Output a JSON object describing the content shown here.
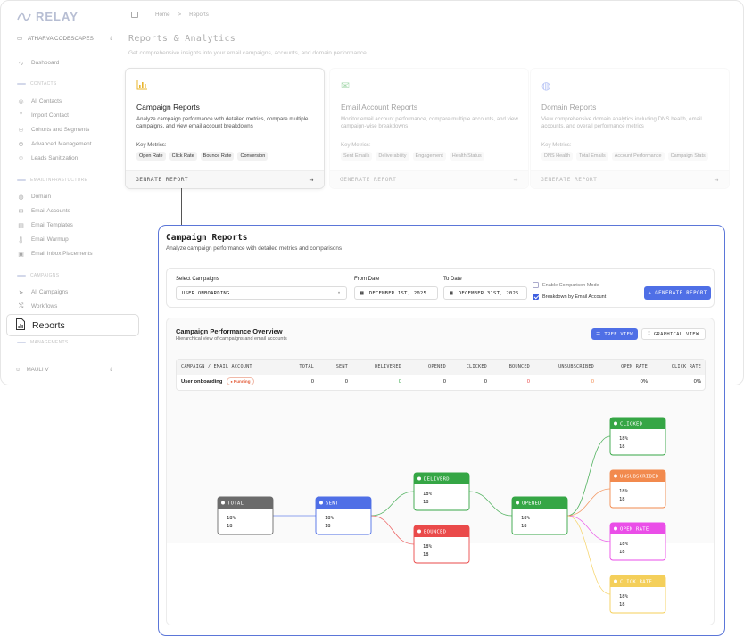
{
  "app": {
    "logo_text": "RELAY",
    "workspace": "ATHARVA CODESCAPES",
    "user": "MAULI V"
  },
  "sidebar": {
    "dashboard": "Dashboard",
    "sections": {
      "contacts": "CONTACTS",
      "email_infra": "EMAIL INFRASTUCTURE",
      "campaigns": "CAMPAIGNS",
      "management": "MANAGEMENTS"
    },
    "contacts_items": [
      "All Contacts",
      "Import Contact",
      "Cohorts and Segments",
      "Advanced Management",
      "Leads Sanitization"
    ],
    "infra_items": [
      "Domain",
      "Email Accounts",
      "Email Templates",
      "Email Warmup",
      "Email Inbox Placements"
    ],
    "campaign_items": [
      "All Campaigns",
      "Workflows"
    ],
    "active": "Reports"
  },
  "breadcrumb": {
    "home": "Home",
    "sep": ">",
    "current": "Reports"
  },
  "page": {
    "title": "Reports & Analytics",
    "subtitle": "Get comprehensive insights into your email campaigns, accounts, and domain performance"
  },
  "cards": [
    {
      "title": "Campaign Reports",
      "desc": "Analyze campaign performance with detailed metrics, compare multiple campaigns, and view email account breakdowns",
      "metrics_label": "Key Metrics:",
      "metrics": [
        "Open Rate",
        "Click Rate",
        "Bounce Rate",
        "Conversion"
      ],
      "action": "GENRATE REPORT"
    },
    {
      "title": "Email Account Reports",
      "desc": "Monitor email account performance, compare multiple accounts, and view campaign-wise breakdowns",
      "metrics_label": "Key Metrics:",
      "metrics": [
        "Sent Emails",
        "Deliverability",
        "Engagement",
        "Health Status"
      ],
      "action": "GENERATE REPORT"
    },
    {
      "title": "Domain Reports",
      "desc": "View comprehensive domain analytics including DNS health, email accounts, and overall performance metrics",
      "metrics_label": "Key Metrics:",
      "metrics": [
        "DNS Health",
        "Total Emails",
        "Account Performance",
        "Campaign Stats"
      ],
      "action": "GENERATE REPORT"
    }
  ],
  "panel": {
    "title": "Campaign Reports",
    "subtitle": "Analyze campaign performance with detailed metrics and comparisons",
    "filters": {
      "campaigns_label": "Select Campaigns",
      "campaigns_value": "USER ONBOARDING",
      "from_label": "From Date",
      "from_value": "DECEMBER 1ST, 2025",
      "to_label": "To Date",
      "to_value": "DECEMBER 31ST, 2025",
      "comparison": {
        "label": "Enable Comparison Mode",
        "checked": false
      },
      "breakdown": {
        "label": "Breakdown by Email Account",
        "checked": true
      },
      "generate": "GENERATE REPORT"
    },
    "overview": {
      "title": "Campaign Performance Overview",
      "subtitle": "Hierarchical view of campaigns and email accounts",
      "tree_view": "TREE VIEW",
      "graphical_view": "GRAPHICAL VIEW",
      "columns": [
        "CAMPAIGN / EMAIL ACCOUNT",
        "TOTAL",
        "SENT",
        "DELIVERED",
        "OPENED",
        "CLICKED",
        "BOUNCED",
        "UNSUBSCRIBED",
        "OPEN RATE",
        "CLICK RATE"
      ],
      "row": {
        "name": "User onboarding",
        "status": "Running",
        "values": [
          "0",
          "0",
          "0",
          "0",
          "0",
          "0",
          "0",
          "0%",
          "0%"
        ]
      }
    },
    "flow": {
      "nodes": [
        {
          "id": "total",
          "title": "TOTAL",
          "pct": "18%",
          "count": "18",
          "color": "#6b6b6b"
        },
        {
          "id": "sent",
          "title": "SENT",
          "pct": "18%",
          "count": "18",
          "color": "#4f6fe6"
        },
        {
          "id": "delivered",
          "title": "DELIVERD",
          "pct": "18%",
          "count": "18",
          "color": "#35a645"
        },
        {
          "id": "bounced",
          "title": "BOUNCED",
          "pct": "18%",
          "count": "18",
          "color": "#ea4a4a"
        },
        {
          "id": "opened",
          "title": "OPENED",
          "pct": "18%",
          "count": "18",
          "color": "#35a645"
        },
        {
          "id": "clicked",
          "title": "CLICKED",
          "pct": "18%",
          "count": "18",
          "color": "#35a645"
        },
        {
          "id": "unsubscribed",
          "title": "UNSUBSCRIBED",
          "pct": "18%",
          "count": "18",
          "color": "#f28a4e"
        },
        {
          "id": "open_rate",
          "title": "OPEN RATE",
          "pct": "18%",
          "count": "18",
          "color": "#ea4ee8"
        },
        {
          "id": "click_rate",
          "title": "CLICK RATE",
          "pct": "18%",
          "count": "18",
          "color": "#f4cf5a"
        }
      ]
    }
  },
  "colors": {
    "accent": "#4f6fe6",
    "panel_border": "#5b76d8"
  }
}
